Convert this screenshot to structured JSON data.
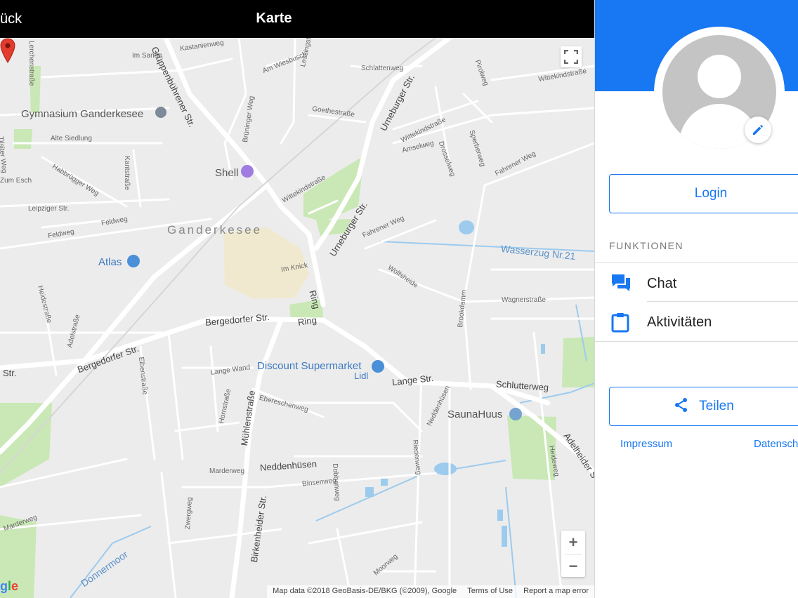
{
  "topbar": {
    "back_label": "ück",
    "title": "Karte"
  },
  "map": {
    "town_name": "Ganderkesee",
    "pois": {
      "gymnasium": "Gymnasium Ganderkesee",
      "shell": "Shell",
      "atlas": "Atlas",
      "discount": "Discount Supermarket",
      "lidl": "Lidl",
      "saunahuus": "SaunaHuus"
    },
    "water": {
      "wasserzug": "Wasserzug Nr.21",
      "donnermoor": "Donnermoor"
    },
    "streets": {
      "im_sande": "Im Sande",
      "kastanienweg": "Kastanienweg",
      "am_wiesbusch": "Am Wiesbusch",
      "lessingstrasse": "Lessingstraße",
      "schlattenweg": "Schlattenweg",
      "pirolweg": "Pirolweg",
      "wittekindstrasse_ne": "Wittekindstraße",
      "grueppenbuehrener": "Grüppenbührener Str.",
      "urneburger_n": "Urneburger Str.",
      "goethestrasse": "Goethestraße",
      "bruninger_weg": "Brüninger Weg",
      "wittekindstrasse_mid": "Wittekindstraße",
      "amselweg": "Amselweg",
      "drosselweg": "Drosselweg",
      "sperberweg": "Sperberweg",
      "fahrener_weg_ne": "Fahrener Weg",
      "alte_siedlung": "Alte Siedlung",
      "habbrugger_weg": "Habbrügger Weg",
      "kantstrasse": "Kantstraße",
      "wittekindstrasse_w": "Wittekindstraße",
      "zum_esch": "Zum Esch",
      "leipziger_str": "Leipziger Str.",
      "feldweg_w": "Feldweg",
      "feldweg": "Feldweg",
      "urneburger_s": "Urneburger Str.",
      "fahrener_weg": "Fahrener Weg",
      "im_knick": "Im Knick",
      "wolfsheide": "Wolfsheide",
      "ring_n": "Ring",
      "ring_s": "Ring",
      "bergedorfer_1": "Bergedorfer Str.",
      "bergedorfer_2": "Bergedorfer Str.",
      "str_w": "Str.",
      "heidestrasse": "Heidestraße",
      "wagnerstrasse": "Wagnerstraße",
      "adelstrasse": "Adelstraße",
      "elbenstrasse": "Elbenstraße",
      "lange_wand": "Lange Wand",
      "lange_str": "Lange Str.",
      "schlutterweg": "Schlutterweg",
      "brookdamm": "Brookdamm",
      "neddenhuesen_v": "Neddenhüsen",
      "ebereschenweg": "Ebereschenweg",
      "muehlenstrasse": "Mühlenstraße",
      "hornstrasse": "Hornstraße",
      "marderweg": "Marderweg",
      "neddenhuesen": "Neddenhüsen",
      "binsenweg": "Binsenweg",
      "dobbenweg": "Dobbenweg",
      "riedenweg": "Riedenweg",
      "heideweg": "Heideweg",
      "adelheider": "Adelheider S",
      "birkenheider": "Birkenheider Str.",
      "zwerg": "Zwergweg",
      "marderweg_s": "Marderweg",
      "moorweg": "Moorweg",
      "tilsiter_weg": "Tilsiter Weg",
      "lerchenstrasse": "Lerchenstraße"
    },
    "attribution": {
      "data": "Map data ©2018 GeoBasis-DE/BKG (©2009), Google",
      "terms": "Terms of Use",
      "report": "Report a map error"
    },
    "google_logo": "gle"
  },
  "panel": {
    "login_label": "Login",
    "section_title": "FUNKTIONEN",
    "menu": [
      {
        "label": "Chat",
        "icon": "chat-icon"
      },
      {
        "label": "Aktivitäten",
        "icon": "clipboard-icon"
      }
    ],
    "share_label": "Teilen",
    "links": {
      "impressum": "Impressum",
      "datenschutz": "Datensch"
    },
    "colors": {
      "accent": "#1877f2",
      "header": "#1877f2"
    }
  }
}
